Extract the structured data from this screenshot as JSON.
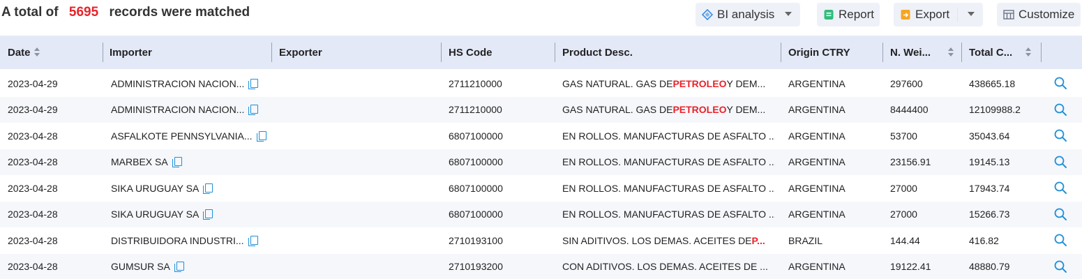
{
  "summary": {
    "prefix": "A total of",
    "count": "5695",
    "suffix": "records were matched"
  },
  "toolbar": {
    "bi_label": "BI analysis",
    "report_label": "Report",
    "export_label": "Export",
    "customize_label": "Customize"
  },
  "columns": [
    {
      "label": "Date",
      "sortable": true
    },
    {
      "label": "Importer",
      "sortable": false
    },
    {
      "label": "Exporter",
      "sortable": false
    },
    {
      "label": "HS Code",
      "sortable": false
    },
    {
      "label": "Product Desc.",
      "sortable": false
    },
    {
      "label": "Origin CTRY",
      "sortable": false
    },
    {
      "label": "N. Wei...",
      "sortable": true
    },
    {
      "label": "Total C...",
      "sortable": true
    }
  ],
  "rows": [
    {
      "date": "2023-04-29",
      "importer": "ADMINISTRACION NACION...",
      "exporter": "",
      "hs": "2711210000",
      "desc_pre": "GAS NATURAL. GAS DE ",
      "desc_hl": "PETROLEO",
      "desc_post": " Y DEM...",
      "origin": "ARGENTINA",
      "weight": "297600",
      "total": "438665.18"
    },
    {
      "date": "2023-04-29",
      "importer": "ADMINISTRACION NACION...",
      "exporter": "",
      "hs": "2711210000",
      "desc_pre": "GAS NATURAL. GAS DE ",
      "desc_hl": "PETROLEO",
      "desc_post": " Y DEM...",
      "origin": "ARGENTINA",
      "weight": "8444400",
      "total": "12109988.2"
    },
    {
      "date": "2023-04-28",
      "importer": "ASFALKOTE PENNSYLVANIA...",
      "exporter": "",
      "hs": "6807100000",
      "desc_pre": "EN ROLLOS. MANUFACTURAS DE ASFALTO ...",
      "desc_hl": "",
      "desc_post": "",
      "origin": "ARGENTINA",
      "weight": "53700",
      "total": "35043.64"
    },
    {
      "date": "2023-04-28",
      "importer": "MARBEX SA",
      "exporter": "",
      "hs": "6807100000",
      "desc_pre": "EN ROLLOS. MANUFACTURAS DE ASFALTO ...",
      "desc_hl": "",
      "desc_post": "",
      "origin": "ARGENTINA",
      "weight": "23156.91",
      "total": "19145.13"
    },
    {
      "date": "2023-04-28",
      "importer": "SIKA URUGUAY SA",
      "exporter": "",
      "hs": "6807100000",
      "desc_pre": "EN ROLLOS. MANUFACTURAS DE ASFALTO ...",
      "desc_hl": "",
      "desc_post": "",
      "origin": "ARGENTINA",
      "weight": "27000",
      "total": "17943.74"
    },
    {
      "date": "2023-04-28",
      "importer": "SIKA URUGUAY SA",
      "exporter": "",
      "hs": "6807100000",
      "desc_pre": "EN ROLLOS. MANUFACTURAS DE ASFALTO ...",
      "desc_hl": "",
      "desc_post": "",
      "origin": "ARGENTINA",
      "weight": "27000",
      "total": "15266.73"
    },
    {
      "date": "2023-04-28",
      "importer": "DISTRIBUIDORA INDUSTRI...",
      "exporter": "",
      "hs": "2710193100",
      "desc_pre": "SIN ADITIVOS. LOS DEMAS. ACEITES DE ",
      "desc_hl": "P...",
      "desc_post": "",
      "origin": "BRAZIL",
      "weight": "144.44",
      "total": "416.82"
    },
    {
      "date": "2023-04-28",
      "importer": "GUMSUR SA",
      "exporter": "",
      "hs": "2710193200",
      "desc_pre": "CON ADITIVOS. LOS DEMAS. ACEITES DE ...",
      "desc_hl": "",
      "desc_post": "",
      "origin": "ARGENTINA",
      "weight": "19122.41",
      "total": "48880.79"
    }
  ],
  "colors": {
    "accent": "#e8232b",
    "link_blue": "#1e8fd8",
    "header_bg": "#e3e9f7",
    "button_bg": "#eef1f8"
  },
  "icons": {
    "bi": "bi-analysis-icon",
    "report": "report-icon",
    "export": "export-icon",
    "customize": "customize-icon",
    "copy": "copy-icon",
    "search": "search-icon"
  }
}
